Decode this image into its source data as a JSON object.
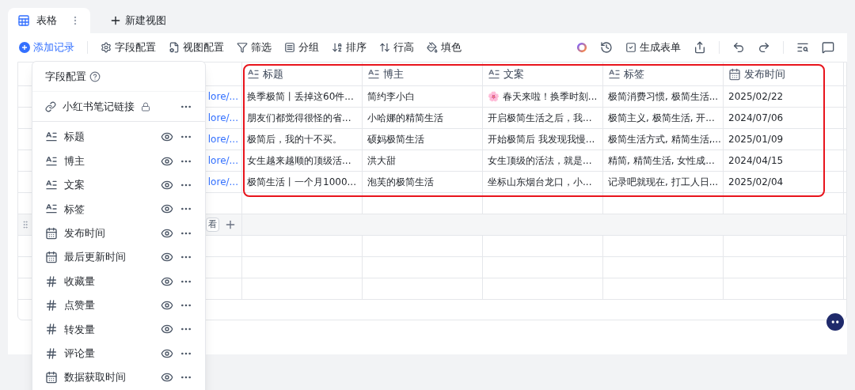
{
  "view_tabs": [
    {
      "label": "表格",
      "selected": true
    }
  ],
  "new_view": "新建视图",
  "toolbar": {
    "add_record": "添加记录",
    "tools": [
      {
        "kind": "fields",
        "label": "字段配置"
      },
      {
        "kind": "view",
        "label": "视图配置"
      },
      {
        "kind": "filter",
        "label": "筛选"
      },
      {
        "kind": "group",
        "label": "分组"
      },
      {
        "kind": "sort",
        "label": "排序"
      },
      {
        "kind": "height",
        "label": "行高"
      },
      {
        "kind": "fill",
        "label": "填色"
      }
    ],
    "generate_form": "生成表单"
  },
  "table": {
    "link_cells": [
      "lore/...",
      "lore/...",
      "lore/...",
      "lore/...",
      "lore/..."
    ],
    "columns": [
      {
        "kind": "text",
        "label": "标题"
      },
      {
        "kind": "text",
        "label": "博主"
      },
      {
        "kind": "text",
        "label": "文案"
      },
      {
        "kind": "text",
        "label": "标签"
      },
      {
        "kind": "date",
        "label": "发布时间"
      }
    ],
    "rows": [
      [
        "换季极简丨丢掉这60件...",
        "简约李小白",
        "🌸 春天来啦！换季时刻...",
        "极简消费习惯, 极简生活...",
        "2025/02/22"
      ],
      [
        "朋友们都觉得很怪的省...",
        "小哈娜的精简生活",
        "开启极简生活之后，我...",
        "极简主义, 极简生活, 开...",
        "2024/07/06"
      ],
      [
        "极简后，我的十不买。",
        "硕妈极简生活",
        "开始极简后 我发现我慢...",
        "极简生活方式, 精简生活,...",
        "2025/01/09"
      ],
      [
        "女生越来越顺的顶级活...",
        "洪大甜",
        "女生顶级的活法，就是...",
        "精简, 精简生活, 女性成...",
        "2024/04/15"
      ],
      [
        "极简生活丨一个月1000...",
        "泡芙的极简生活",
        "坐标山东烟台龙口，小...",
        "记录吧就现在, 打工人日...",
        "2025/02/04"
      ]
    ],
    "group_label": "看"
  },
  "field_panel": {
    "title": "字段配置",
    "primary_field": {
      "label": "小红书笔记链接",
      "locked": true
    },
    "fields": [
      {
        "kind": "text",
        "label": "标题",
        "visible": true
      },
      {
        "kind": "text",
        "label": "博主",
        "visible": true
      },
      {
        "kind": "text",
        "label": "文案",
        "visible": true
      },
      {
        "kind": "text",
        "label": "标签",
        "visible": true
      },
      {
        "kind": "date",
        "label": "发布时间",
        "visible": true
      },
      {
        "kind": "date",
        "label": "最后更新时间",
        "visible": true
      },
      {
        "kind": "number",
        "label": "收藏量",
        "visible": true
      },
      {
        "kind": "number",
        "label": "点赞量",
        "visible": true
      },
      {
        "kind": "number",
        "label": "转发量",
        "visible": true
      },
      {
        "kind": "number",
        "label": "评论量",
        "visible": true
      },
      {
        "kind": "date",
        "label": "数据获取时间",
        "visible": true
      }
    ]
  }
}
